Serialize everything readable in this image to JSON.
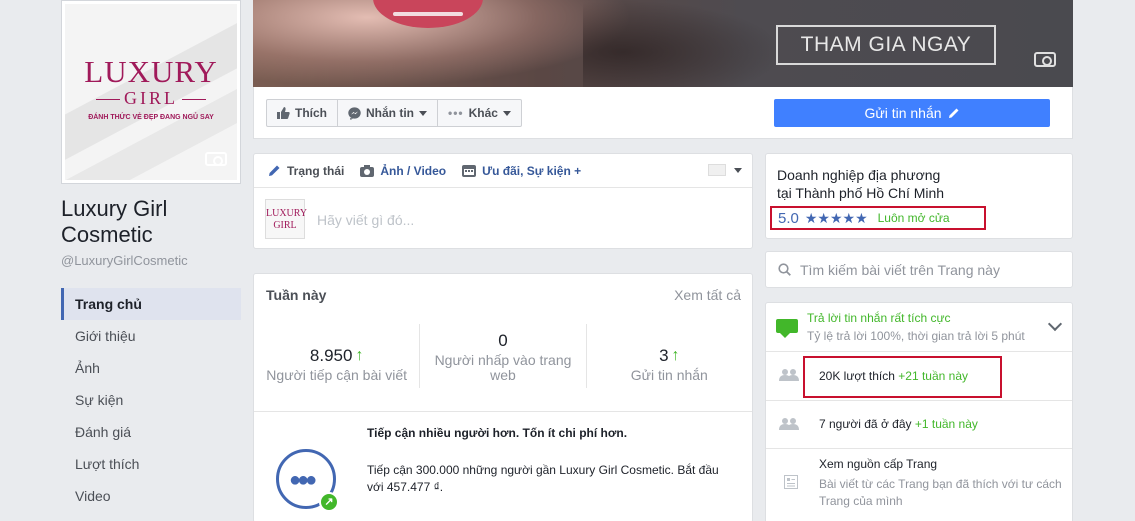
{
  "page": {
    "logo": {
      "brand": "LUXURY",
      "sub": "GIRL",
      "tagline": "ĐÁNH THỨC VẺ ĐẸP ĐANG NGỦ SAY"
    },
    "name": "Luxury Girl Cosmetic",
    "handle": "@LuxuryGirlCosmetic"
  },
  "nav": {
    "items": [
      {
        "label": "Trang chủ",
        "active": true
      },
      {
        "label": "Giới thiệu"
      },
      {
        "label": "Ảnh"
      },
      {
        "label": "Sự kiện"
      },
      {
        "label": "Đánh giá"
      },
      {
        "label": "Lượt thích"
      },
      {
        "label": "Video"
      }
    ]
  },
  "cover": {
    "cta": "THAM GIA NGAY"
  },
  "actions": {
    "like": "Thích",
    "message": "Nhắn tin",
    "more": "Khác",
    "send_message": "Gửi tin nhắn"
  },
  "composer": {
    "tabs": {
      "status": "Trạng thái",
      "photo": "Ảnh / Video",
      "offer": "Ưu đãi, Sự kiện +"
    },
    "avatar_text": "LUXURY GIRL",
    "placeholder": "Hãy viết gì đó..."
  },
  "week": {
    "title": "Tuần này",
    "see_all": "Xem tất cả",
    "stats": [
      {
        "value": "8.950",
        "trend": "up",
        "label": "Người tiếp cận bài viết"
      },
      {
        "value": "0",
        "trend": "",
        "label": "Người nhấp vào trang web"
      },
      {
        "value": "3",
        "trend": "up",
        "label": "Gửi tin nhắn"
      }
    ],
    "promo": {
      "title": "Tiếp cận nhiều người hơn. Tốn ít chi phí hơn.",
      "text": "Tiếp cận 300.000 những người gần Luxury Girl Cosmetic. Bắt đầu với 457.477 ₫."
    }
  },
  "business": {
    "type_line1": "Doanh nghiệp địa phương",
    "type_line2": "tại Thành phố Hồ Chí Minh",
    "rating": "5.0",
    "stars": "★★★★★",
    "status": "Luôn mở cửa"
  },
  "search": {
    "placeholder": "Tìm kiếm bài viết trên Trang này"
  },
  "info": {
    "response_title": "Trả lời tin nhắn rất tích cực",
    "response_sub": "Tỷ lệ trả lời 100%, thời gian trả lời 5 phút",
    "likes": "20K lượt thích",
    "likes_delta": "+21 tuần này",
    "checkins": "7 người đã ở đây",
    "checkins_delta": "+1 tuần này",
    "feed_title": "Xem nguồn cấp Trang",
    "feed_sub": "Bài viết từ các Trang bạn đã thích với tư cách Trang của mình"
  },
  "colors": {
    "accent": "#4267b2",
    "send_button": "#4080ff",
    "green": "#42b72a",
    "highlight": "#c8102e",
    "brand": "#a01a5a"
  }
}
